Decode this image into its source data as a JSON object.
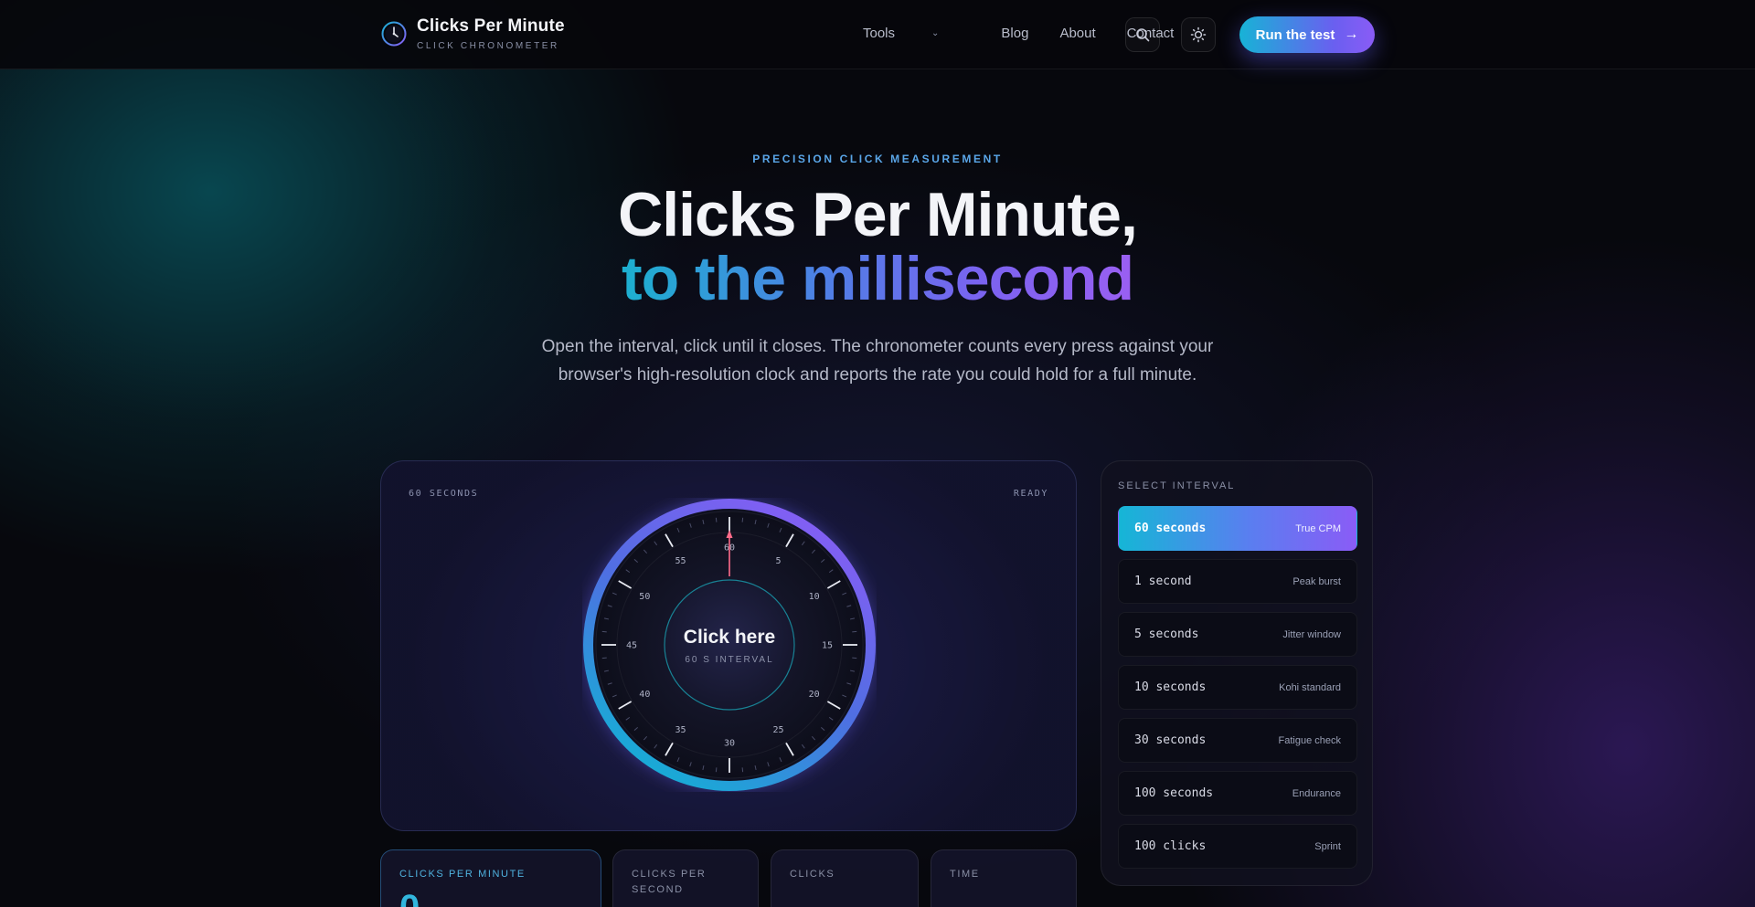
{
  "brand": {
    "title": "Clicks Per Minute",
    "subtitle": "CLICK CHRONOMETER"
  },
  "nav": {
    "links": [
      "Tools",
      "Blog",
      "About",
      "Contact"
    ],
    "cta_label": "Run the test"
  },
  "hero": {
    "eyebrow": "PRECISION CLICK MEASUREMENT",
    "title_line1": "Clicks Per Minute,",
    "title_line2": "to the millisecond",
    "lead": "Open the interval, click until it closes. The chronometer counts every press against your browser's high-resolution clock and reports the rate you could hold for a full minute."
  },
  "test": {
    "interval_label": "60 SECONDS",
    "status": "READY",
    "button_label": "Click here",
    "button_sub": "60 S INTERVAL",
    "dial_numbers": [
      "60",
      "5",
      "10",
      "15",
      "20",
      "25",
      "30",
      "35",
      "40",
      "45",
      "50",
      "55"
    ]
  },
  "intervals": {
    "title": "SELECT INTERVAL",
    "options": [
      {
        "label": "60 seconds",
        "tag": "True CPM",
        "active": true
      },
      {
        "label": "1 second",
        "tag": "Peak burst",
        "active": false
      },
      {
        "label": "5 seconds",
        "tag": "Jitter window",
        "active": false
      },
      {
        "label": "10 seconds",
        "tag": "Kohi standard",
        "active": false
      },
      {
        "label": "30 seconds",
        "tag": "Fatigue check",
        "active": false
      },
      {
        "label": "100 seconds",
        "tag": "Endurance",
        "active": false
      },
      {
        "label": "100 clicks",
        "tag": "Sprint",
        "active": false
      }
    ]
  },
  "stats": [
    {
      "label": "CLICKS PER MINUTE",
      "value": "0"
    },
    {
      "label": "CLICKS PER SECOND",
      "value": ""
    },
    {
      "label": "CLICKS",
      "value": ""
    },
    {
      "label": "TIME",
      "value": ""
    }
  ],
  "colors": {
    "accent_cyan": "#17b3d6",
    "accent_violet": "#8a5cf6",
    "needle": "#ff6b8a",
    "background": "#07080d"
  }
}
